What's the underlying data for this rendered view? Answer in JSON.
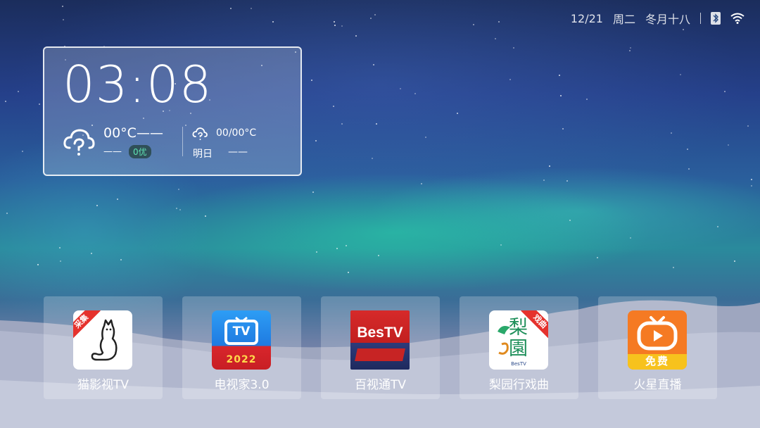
{
  "status_bar": {
    "date": "12/21",
    "weekday": "周二",
    "lunar_date": "冬月十八",
    "icons": [
      "bluetooth-icon",
      "wifi-icon"
    ]
  },
  "clock_card": {
    "time": "03:08",
    "current_temp": "00°C——",
    "current_desc": "——",
    "aqi": "0优",
    "tomorrow_temp": "00/00°C",
    "tomorrow_label": "明日",
    "tomorrow_desc": "——",
    "weather_icon": "cloud-unknown-icon"
  },
  "apps": [
    {
      "label": "猫影视TV",
      "badge": "采集",
      "icon": "cat-icon"
    },
    {
      "label": "电视家3.0",
      "icon": "tv-icon",
      "tile_text": "TV",
      "year": "2022"
    },
    {
      "label": "百视通TV",
      "icon": "bestv-icon",
      "tile_text": "BesTV"
    },
    {
      "label": "梨园行戏曲",
      "badge": "戏曲",
      "icon": "opera-icon",
      "tile_text": "梨園",
      "sub_text": "BesTV"
    },
    {
      "label": "火星直播",
      "icon": "play-tv-icon",
      "tile_text": "免费"
    }
  ],
  "colors": {
    "card_border": "#ffffff",
    "aqi_green": "#5fe3b2",
    "tv_blue": "#2d8ef0",
    "bestv_red": "#d62a2a",
    "huoxing_orange": "#f57a23"
  }
}
